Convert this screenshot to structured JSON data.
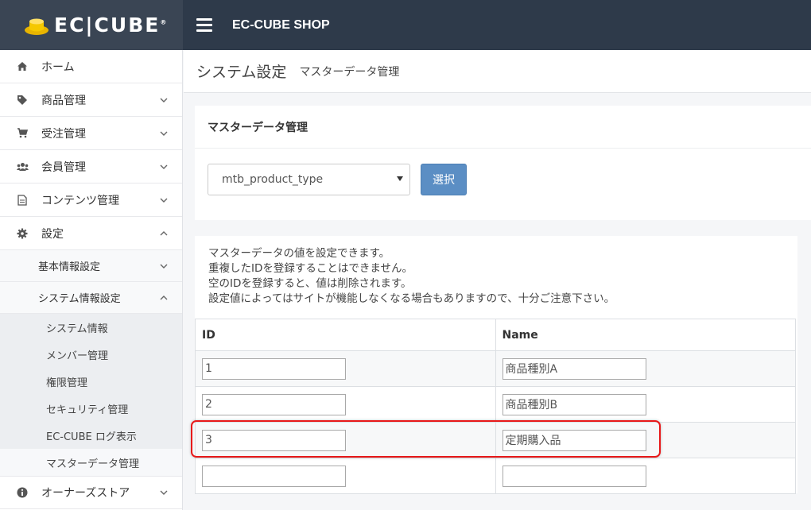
{
  "logo": {
    "text": "EC|CUBE",
    "mark": "®"
  },
  "header": {
    "shop_name": "EC-CUBE SHOP"
  },
  "sidebar": {
    "items": [
      {
        "label": "ホーム",
        "icon": "home-icon"
      },
      {
        "label": "商品管理",
        "icon": "tag-icon"
      },
      {
        "label": "受注管理",
        "icon": "cart-icon"
      },
      {
        "label": "会員管理",
        "icon": "users-icon"
      },
      {
        "label": "コンテンツ管理",
        "icon": "file-icon"
      },
      {
        "label": "設定",
        "icon": "gear-icon"
      }
    ],
    "settings_sub": [
      {
        "label": "基本情報設定"
      },
      {
        "label": "システム情報設定"
      }
    ],
    "system_leaves": [
      {
        "label": "システム情報"
      },
      {
        "label": "メンバー管理"
      },
      {
        "label": "権限管理"
      },
      {
        "label": "セキュリティ管理"
      },
      {
        "label": "EC-CUBE ログ表示"
      },
      {
        "label": "マスターデータ管理"
      }
    ],
    "owner_store": {
      "label": "オーナーズストア",
      "icon": "info-icon"
    }
  },
  "page": {
    "title": "システム設定",
    "subtitle": "マスターデータ管理"
  },
  "master_card": {
    "title": "マスターデータ管理",
    "selected_table": "mtb_product_type",
    "select_button": "選択"
  },
  "data_card": {
    "desc": [
      "マスターデータの値を設定できます。",
      "重複したIDを登録することはできません。",
      "空のIDを登録すると、値は削除されます。",
      "設定値によってはサイトが機能しなくなる場合もありますので、十分ご注意下さい。"
    ],
    "columns": {
      "id": "ID",
      "name": "Name"
    },
    "rows": [
      {
        "id": "1",
        "name": "商品種別A"
      },
      {
        "id": "2",
        "name": "商品種別B"
      },
      {
        "id": "3",
        "name": "定期購入品"
      },
      {
        "id": "",
        "name": ""
      }
    ]
  },
  "colors": {
    "header_bg": "#2e3a4a",
    "logo_bg": "#3a4554",
    "button": "#5b8ec4",
    "highlight": "#e8191a"
  }
}
